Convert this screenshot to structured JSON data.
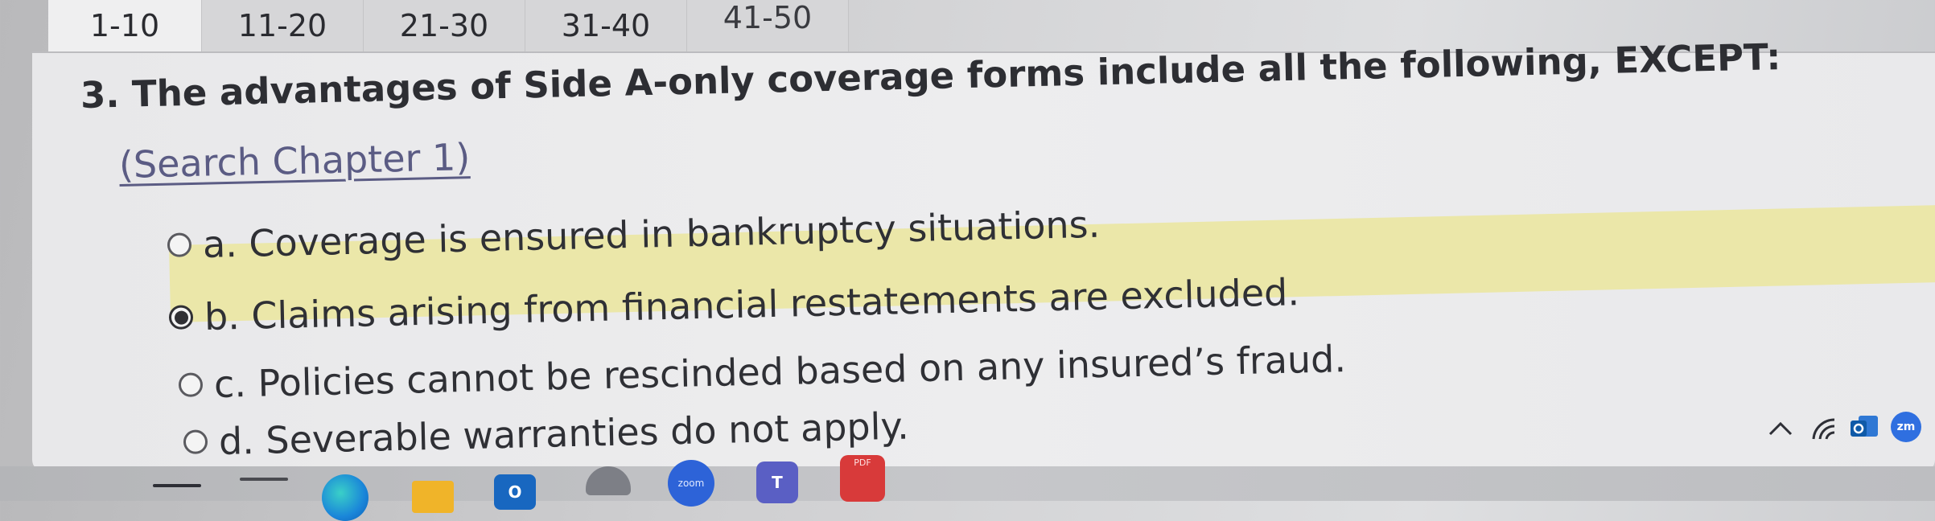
{
  "tabs": [
    "1-10",
    "11-20",
    "21-30",
    "31-40",
    "41-50"
  ],
  "question": {
    "title": "3. The advantages of Side A-only coverage forms include all the following, EXCEPT:",
    "chapter_link": "(Search Chapter 1)",
    "options": [
      {
        "label": "a. Coverage is ensured in bankruptcy situations.",
        "selected": false
      },
      {
        "label": "b. Claims arising from financial restatements are excluded.",
        "selected": true
      },
      {
        "label": "c. Policies cannot be rescinded based on any insured’s fraud.",
        "selected": false
      },
      {
        "label": "d. Severable warranties do not apply.",
        "selected": false
      }
    ]
  },
  "taskbar": {
    "icons": [
      "edge-icon",
      "file-explorer-icon",
      "outlook-icon",
      "snipping-tool-icon",
      "zoom-icon",
      "teams-icon",
      "pdf-editor-icon"
    ],
    "zoom_label": "zoom",
    "pdf_label": "PDF",
    "tray_icons": [
      "chevron-up-icon",
      "wifi-icon",
      "outlook-tray-icon",
      "zoom-tray-icon"
    ],
    "tray_zoom_label": "zm"
  },
  "colors": {
    "highlight": "#ebe7a9",
    "link": "#5b5c84",
    "text": "#2f3035"
  }
}
